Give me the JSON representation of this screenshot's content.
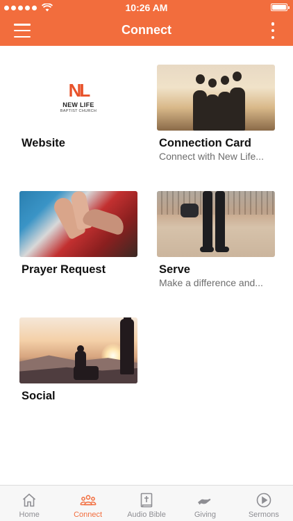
{
  "status_bar": {
    "time": "10:26 AM",
    "signal_dots": 5
  },
  "header": {
    "title": "Connect",
    "color": "#f26d3d"
  },
  "logo": {
    "mark": "NL",
    "name": "NEW LIFE",
    "subtitle": "BAPTIST CHURCH"
  },
  "cards": [
    {
      "title": "Website",
      "subtitle": ""
    },
    {
      "title": "Connection Card",
      "subtitle": "Connect with New Life..."
    },
    {
      "title": "Prayer Request",
      "subtitle": ""
    },
    {
      "title": "Serve",
      "subtitle": "Make a difference and..."
    },
    {
      "title": "Social",
      "subtitle": ""
    }
  ],
  "tabs": [
    {
      "label": "Home",
      "icon": "home-icon"
    },
    {
      "label": "Connect",
      "icon": "people-icon",
      "active": true
    },
    {
      "label": "Audio Bible",
      "icon": "bible-icon"
    },
    {
      "label": "Giving",
      "icon": "giving-hand-icon"
    },
    {
      "label": "Sermons",
      "icon": "play-circle-icon"
    }
  ],
  "colors": {
    "accent": "#f26d3d",
    "tab_inactive": "#8e8e93",
    "subtitle_text": "#6c6c6c"
  }
}
